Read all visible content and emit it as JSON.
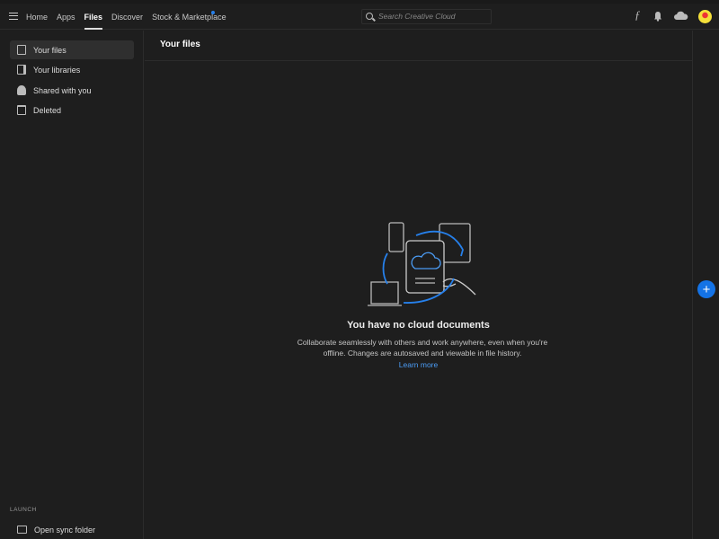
{
  "nav": {
    "items": [
      "Home",
      "Apps",
      "Files",
      "Discover",
      "Stock & Marketplace"
    ],
    "active": "Files",
    "notification_color": "#2680eb"
  },
  "search": {
    "placeholder": "Search Creative Cloud"
  },
  "header_icons": [
    "fonts-icon",
    "bell-icon",
    "cloud-icon",
    "avatar"
  ],
  "sidebar": {
    "items": [
      {
        "label": "Your files",
        "icon": "file-icon"
      },
      {
        "label": "Your libraries",
        "icon": "library-icon"
      },
      {
        "label": "Shared with you",
        "icon": "shared-users-icon"
      },
      {
        "label": "Deleted",
        "icon": "trash-icon"
      }
    ],
    "launch_label": "LAUNCH",
    "launch_items": [
      {
        "label": "Open sync folder",
        "icon": "folder-sync-icon"
      }
    ]
  },
  "main": {
    "title": "Your files",
    "empty_title": "You have no cloud documents",
    "empty_desc": "Collaborate seamlessly with others and work anywhere, even when you're offline. Changes are autosaved and viewable in file history.",
    "learn_more": "Learn more"
  },
  "fab": {
    "label": "+",
    "color": "#1473e6"
  },
  "accent": "#2680eb"
}
